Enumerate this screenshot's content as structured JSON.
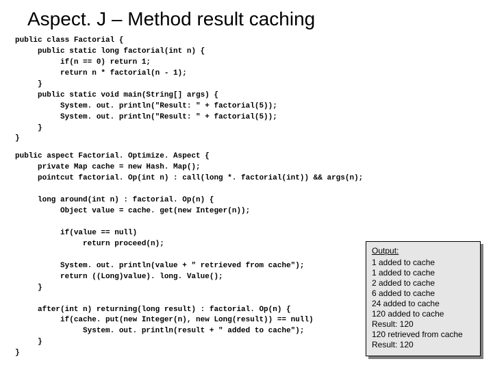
{
  "title": "Aspect. J – Method result caching",
  "code1": "public class Factorial {\n     public static long factorial(int n) {\n          if(n == 0) return 1;\n          return n * factorial(n - 1);\n     }\n     public static void main(String[] args) {\n          System. out. println(\"Result: \" + factorial(5));\n          System. out. println(\"Result: \" + factorial(5));\n     }\n}",
  "code2": "public aspect Factorial. Optimize. Aspect {\n     private Map cache = new Hash. Map();\n     pointcut factorial. Op(int n) : call(long *. factorial(int)) && args(n);\n\n     long around(int n) : factorial. Op(n) {\n          Object value = cache. get(new Integer(n));\n\n          if(value == null)\n               return proceed(n);\n\n          System. out. println(value + \" retrieved from cache\");\n          return ((Long)value). long. Value();\n     }\n\n     after(int n) returning(long result) : factorial. Op(n) {\n          if(cache. put(new Integer(n), new Long(result)) == null)\n               System. out. println(result + \" added to cache\");\n     }\n}",
  "output": {
    "title": "Output:",
    "lines": [
      "1 added to cache",
      "1 added to cache",
      "2 added to cache",
      "6 added to cache",
      "24 added to cache",
      "120 added to cache",
      "Result: 120",
      "120 retrieved from cache",
      "Result: 120"
    ]
  }
}
